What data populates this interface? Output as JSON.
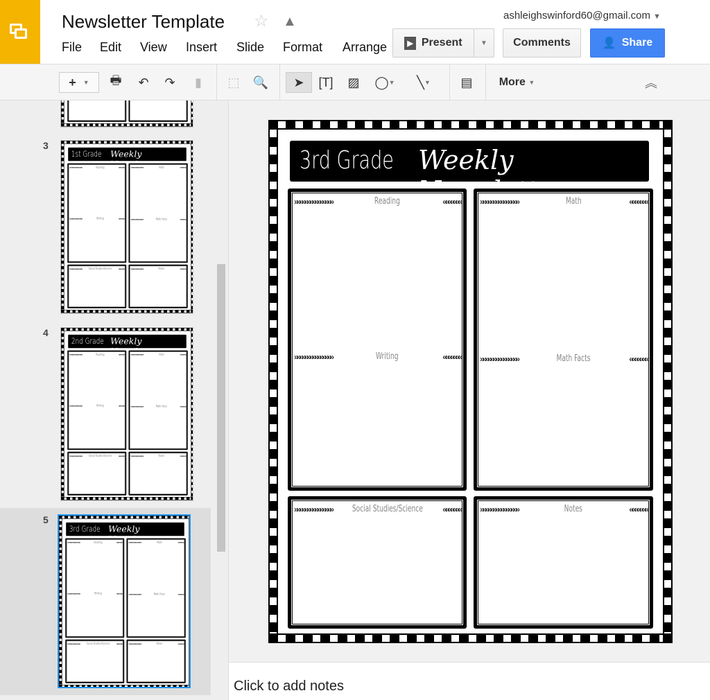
{
  "header": {
    "title": "Newsletter Template",
    "account": "ashleighswinford60@gmail.com",
    "menu": [
      "File",
      "Edit",
      "View",
      "Insert",
      "Slide",
      "Format",
      "Arrange"
    ],
    "present": "Present",
    "comments": "Comments",
    "share": "Share",
    "accent": "#4285f4"
  },
  "toolbar": {
    "more": "More"
  },
  "sidebar": {
    "slides": [
      {
        "number": "3",
        "grade": "1st Grade"
      },
      {
        "number": "4",
        "grade": "2nd Grade"
      },
      {
        "number": "5",
        "grade": "3rd Grade",
        "selected": true
      }
    ]
  },
  "slide": {
    "grade": "3rd Grade",
    "title": "Weekly Newsletter",
    "sections": {
      "reading": "Reading",
      "writing": "Writing",
      "math": "Math",
      "math_facts": "Math Facts",
      "social": "Social Studies/Science",
      "notes": "Notes"
    },
    "arrows_right": "»»»»»»»»»»»»»»»",
    "arrows_left": "«««««««"
  },
  "notes": {
    "placeholder": "Click to add notes"
  }
}
